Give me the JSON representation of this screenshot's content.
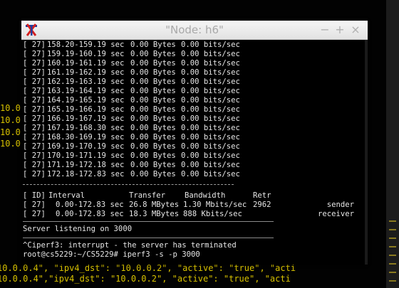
{
  "window": {
    "title": "\"Node: h6\""
  },
  "background_terminal": {
    "left_lines": [
      "10.0",
      "10.0",
      "10.0",
      "10.0"
    ],
    "bottom_lines": [
      "10.0.0.4\", \"ipv4_dst\": \"10.0.0.2\", \"active\": \"true\", \"acti",
      "10.0.0.4\",\"ipv4_dst\": \"10.0.0.2\", \"active\": \"true\", \"acti"
    ]
  },
  "interval_rows": [
    {
      "id": "[ 27]",
      "interval": "158.20-159.19 sec",
      "transfer": "0.00 Bytes",
      "bandwidth": "0.00 bits/sec"
    },
    {
      "id": "[ 27]",
      "interval": "159.19-160.19 sec",
      "transfer": "0.00 Bytes",
      "bandwidth": "0.00 bits/sec"
    },
    {
      "id": "[ 27]",
      "interval": "160.19-161.19 sec",
      "transfer": "0.00 Bytes",
      "bandwidth": "0.00 bits/sec"
    },
    {
      "id": "[ 27]",
      "interval": "161.19-162.19 sec",
      "transfer": "0.00 Bytes",
      "bandwidth": "0.00 bits/sec"
    },
    {
      "id": "[ 27]",
      "interval": "162.19-163.19 sec",
      "transfer": "0.00 Bytes",
      "bandwidth": "0.00 bits/sec"
    },
    {
      "id": "[ 27]",
      "interval": "163.19-164.19 sec",
      "transfer": "0.00 Bytes",
      "bandwidth": "0.00 bits/sec"
    },
    {
      "id": "[ 27]",
      "interval": "164.19-165.19 sec",
      "transfer": "0.00 Bytes",
      "bandwidth": "0.00 bits/sec"
    },
    {
      "id": "[ 27]",
      "interval": "165.19-166.19 sec",
      "transfer": "0.00 Bytes",
      "bandwidth": "0.00 bits/sec"
    },
    {
      "id": "[ 27]",
      "interval": "166.19-167.19 sec",
      "transfer": "0.00 Bytes",
      "bandwidth": "0.00 bits/sec"
    },
    {
      "id": "[ 27]",
      "interval": "167.19-168.30 sec",
      "transfer": "0.00 Bytes",
      "bandwidth": "0.00 bits/sec"
    },
    {
      "id": "[ 27]",
      "interval": "168.30-169.19 sec",
      "transfer": "0.00 Bytes",
      "bandwidth": "0.00 bits/sec"
    },
    {
      "id": "[ 27]",
      "interval": "169.19-170.19 sec",
      "transfer": "0.00 Bytes",
      "bandwidth": "0.00 bits/sec"
    },
    {
      "id": "[ 27]",
      "interval": "170.19-171.19 sec",
      "transfer": "0.00 Bytes",
      "bandwidth": "0.00 bits/sec"
    },
    {
      "id": "[ 27]",
      "interval": "171.19-172.18 sec",
      "transfer": "0.00 Bytes",
      "bandwidth": "0.00 bits/sec"
    },
    {
      "id": "[ 27]",
      "interval": "172.18-172.83 sec",
      "transfer": "0.00 Bytes",
      "bandwidth": "0.00 bits/sec"
    }
  ],
  "summary": {
    "header": {
      "id": "[ ID]",
      "interval": "Interval",
      "transfer": "Transfer",
      "bandwidth": "Bandwidth",
      "retr": "Retr"
    },
    "rows": [
      {
        "id": "[ 27]",
        "interval": "0.00-172.83 sec",
        "transfer": "26.8 MBytes",
        "bandwidth": "1.30 Mbits/sec",
        "retr": "2962",
        "role": "sender"
      },
      {
        "id": "[ 27]",
        "interval": "0.00-172.83 sec",
        "transfer": "18.3 MBytes",
        "bandwidth": "888 Kbits/sec",
        "retr": "",
        "role": "receiver"
      }
    ]
  },
  "server_listening": "Server listening on 3000",
  "interrupt_message": "^Ciperf3: interrupt - the server has terminated",
  "prompt": "root@cs5229:~/CS5229# iperf3 -s -p 3000",
  "colors": {
    "terminal_bg": "#000000",
    "terminal_fg": "#e6e6e6",
    "bg_yellow": "#d8c200",
    "icon_red": "#d42020",
    "icon_blue": "#1f3f9f"
  }
}
